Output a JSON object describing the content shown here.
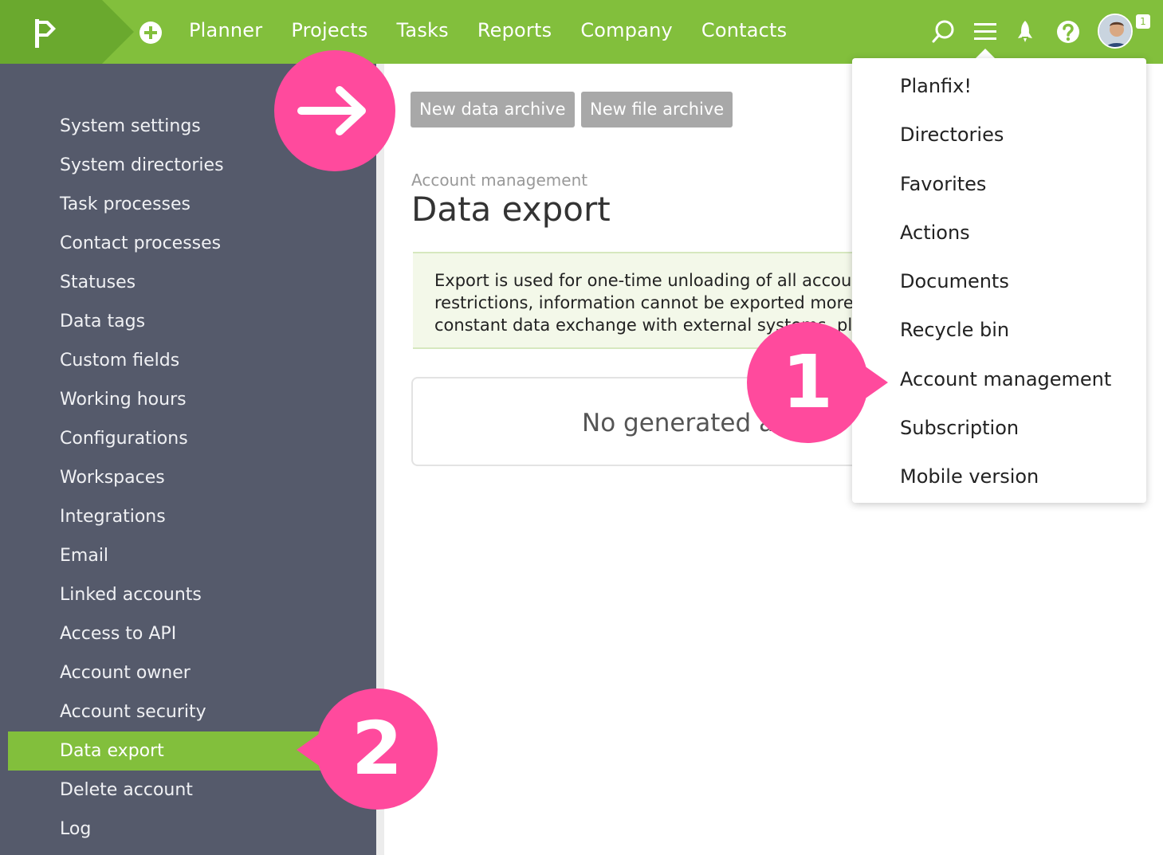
{
  "colors": {
    "brand_green": "#82bf3c",
    "sidebar_bg": "#555a6b",
    "callout_pink": "#ff4a9d",
    "info_bg": "#f3f8e9"
  },
  "header": {
    "logo_icon": "flag-icon",
    "add_icon": "plus-circle-icon",
    "nav": [
      "Planner",
      "Projects",
      "Tasks",
      "Reports",
      "Company",
      "Contacts"
    ],
    "icons": [
      "search-icon",
      "menu-icon",
      "rocket-icon",
      "help-icon"
    ],
    "notification_count": "1"
  },
  "sidebar": {
    "items": [
      {
        "label": "System settings",
        "active": false
      },
      {
        "label": "System directories",
        "active": false
      },
      {
        "label": "Task processes",
        "active": false
      },
      {
        "label": "Contact processes",
        "active": false
      },
      {
        "label": "Statuses",
        "active": false
      },
      {
        "label": "Data tags",
        "active": false
      },
      {
        "label": "Custom fields",
        "active": false
      },
      {
        "label": "Working hours",
        "active": false
      },
      {
        "label": "Configurations",
        "active": false
      },
      {
        "label": "Workspaces",
        "active": false
      },
      {
        "label": "Integrations",
        "active": false
      },
      {
        "label": "Email",
        "active": false
      },
      {
        "label": "Linked accounts",
        "active": false
      },
      {
        "label": "Access to API",
        "active": false
      },
      {
        "label": "Account owner",
        "active": false
      },
      {
        "label": "Account security",
        "active": false
      },
      {
        "label": "Data export",
        "active": true
      },
      {
        "label": "Delete account",
        "active": false
      },
      {
        "label": "Log",
        "active": false
      }
    ]
  },
  "main": {
    "buttons": {
      "new_data_archive": "New data archive",
      "new_file_archive": "New file archive"
    },
    "breadcrumb": "Account management",
    "title": "Data export",
    "info_lines": [
      "Export is used for one-time unloading of all accou",
      "restrictions, information cannot be exported more",
      "constant data exchange with external systems, pl"
    ],
    "empty_text": "No generated ar"
  },
  "dropdown": {
    "items": [
      "Planfix!",
      "Directories",
      "Favorites",
      "Actions",
      "Documents",
      "Recycle bin",
      "Account management",
      "Subscription",
      "Mobile version"
    ]
  },
  "callouts": {
    "arrow_icon": "arrow-right-icon",
    "step1": "1",
    "step2": "2"
  }
}
